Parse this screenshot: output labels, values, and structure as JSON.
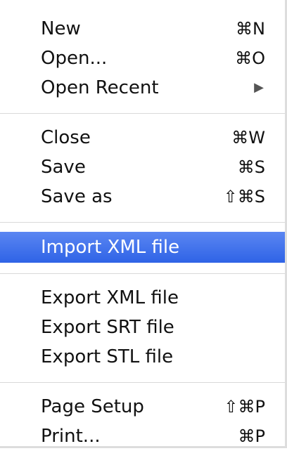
{
  "menu": {
    "groups": [
      [
        {
          "label": "New",
          "shortcut": "⌘N"
        },
        {
          "label": "Open...",
          "shortcut": "⌘O"
        },
        {
          "label": "Open Recent",
          "submenu_icon": "triangle-right-icon",
          "submenu_glyph": "▶"
        }
      ],
      [
        {
          "label": "Close",
          "shortcut": "⌘W"
        },
        {
          "label": "Save",
          "shortcut": "⌘S"
        },
        {
          "label": "Save as",
          "shortcut": "⇧⌘S"
        }
      ],
      [
        {
          "label": "Import XML file",
          "highlighted": true
        }
      ],
      [
        {
          "label": "Export XML file"
        },
        {
          "label": "Export SRT file"
        },
        {
          "label": "Export STL file"
        }
      ],
      [
        {
          "label": "Page Setup",
          "shortcut": "⇧⌘P"
        },
        {
          "label": "Print...",
          "shortcut": "⌘P"
        }
      ]
    ],
    "highlight_color": "#3f72ec"
  }
}
